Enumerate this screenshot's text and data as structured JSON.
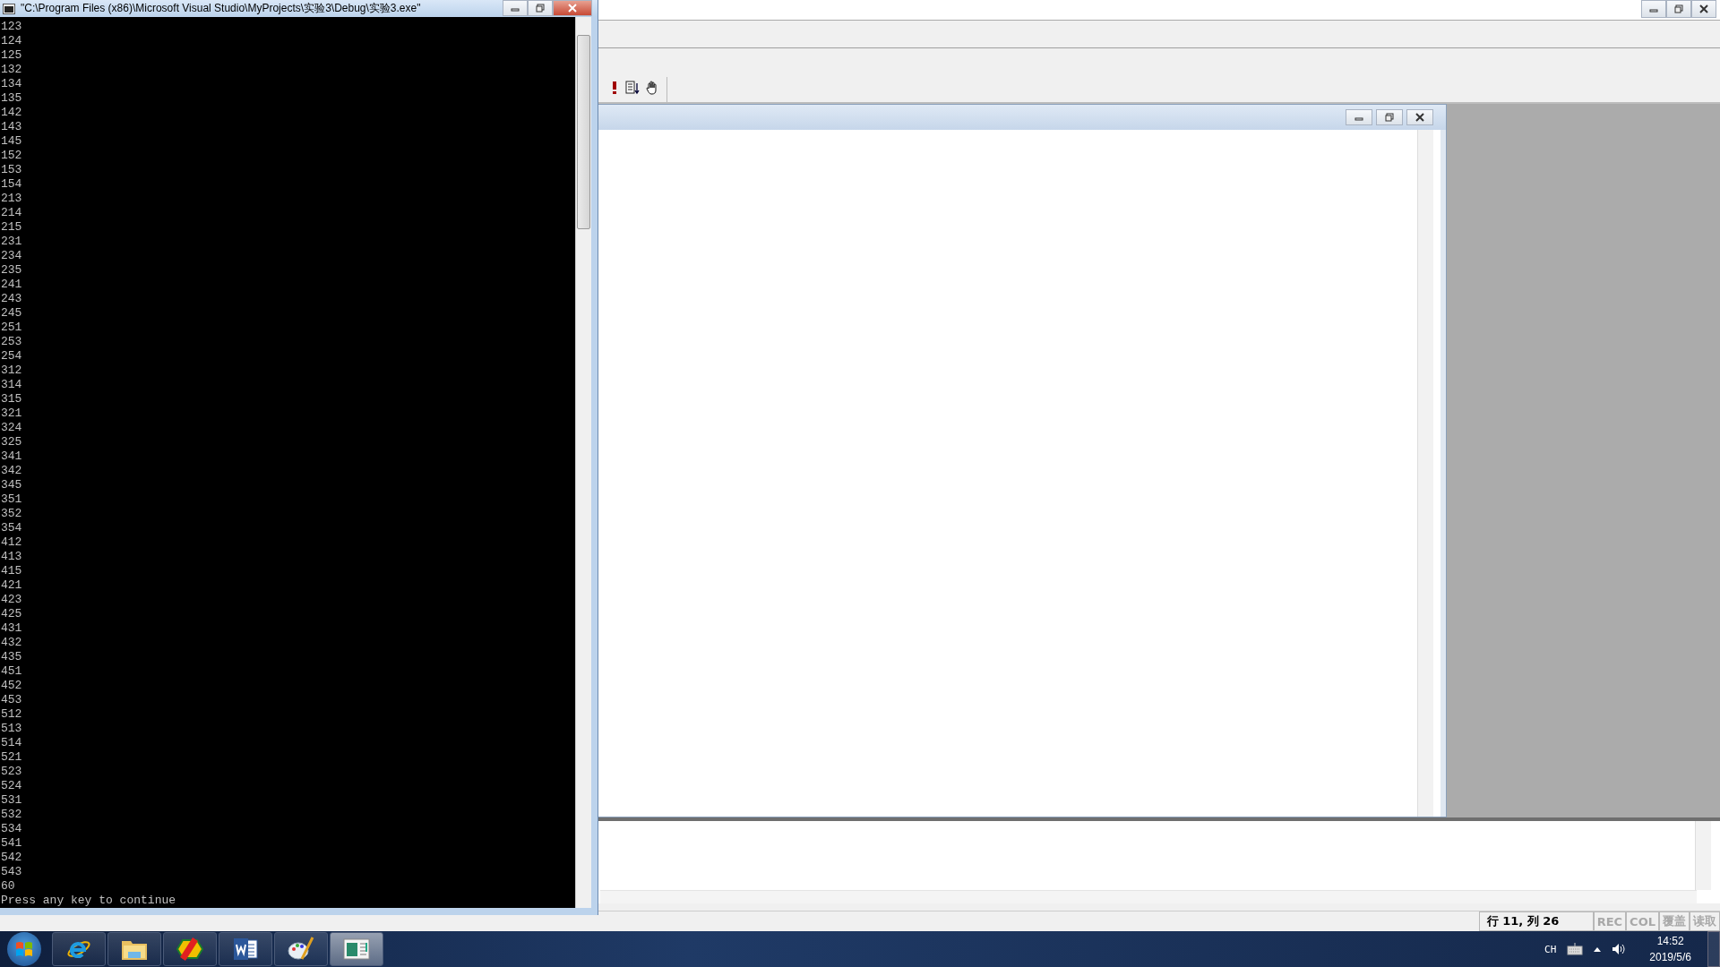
{
  "console": {
    "title": "\"C:\\Program Files (x86)\\Microsoft Visual Studio\\MyProjects\\实验3\\Debug\\实验3.exe\"",
    "lines": [
      "123",
      "124",
      "125",
      "132",
      "134",
      "135",
      "142",
      "143",
      "145",
      "152",
      "153",
      "154",
      "213",
      "214",
      "215",
      "231",
      "234",
      "235",
      "241",
      "243",
      "245",
      "251",
      "253",
      "254",
      "312",
      "314",
      "315",
      "321",
      "324",
      "325",
      "341",
      "342",
      "345",
      "351",
      "352",
      "354",
      "412",
      "413",
      "415",
      "421",
      "423",
      "425",
      "431",
      "432",
      "435",
      "451",
      "452",
      "453",
      "512",
      "513",
      "514",
      "521",
      "523",
      "524",
      "531",
      "532",
      "534",
      "541",
      "542",
      "543",
      "60",
      "Press any key to continue"
    ]
  },
  "toolbar": {
    "items": [
      {
        "kind": "execute"
      },
      {
        "kind": "list"
      },
      {
        "kind": "hand"
      }
    ]
  },
  "status_bar": {
    "position": "行 11, 列 26",
    "indicators": [
      {
        "label": "REC",
        "disabled": true
      },
      {
        "label": "COL",
        "disabled": true
      },
      {
        "label": "覆盖",
        "disabled": true
      },
      {
        "label": "读取",
        "disabled": true
      }
    ]
  },
  "taskbar": {
    "apps": [
      {
        "kind": "browser",
        "active": false
      },
      {
        "kind": "folder",
        "active": false
      },
      {
        "kind": "studio",
        "active": false
      },
      {
        "kind": "word",
        "active": false
      },
      {
        "kind": "paint",
        "active": false
      },
      {
        "kind": "window",
        "active": true
      }
    ],
    "language": "CH",
    "time": "14:52",
    "date": "2019/5/6"
  }
}
